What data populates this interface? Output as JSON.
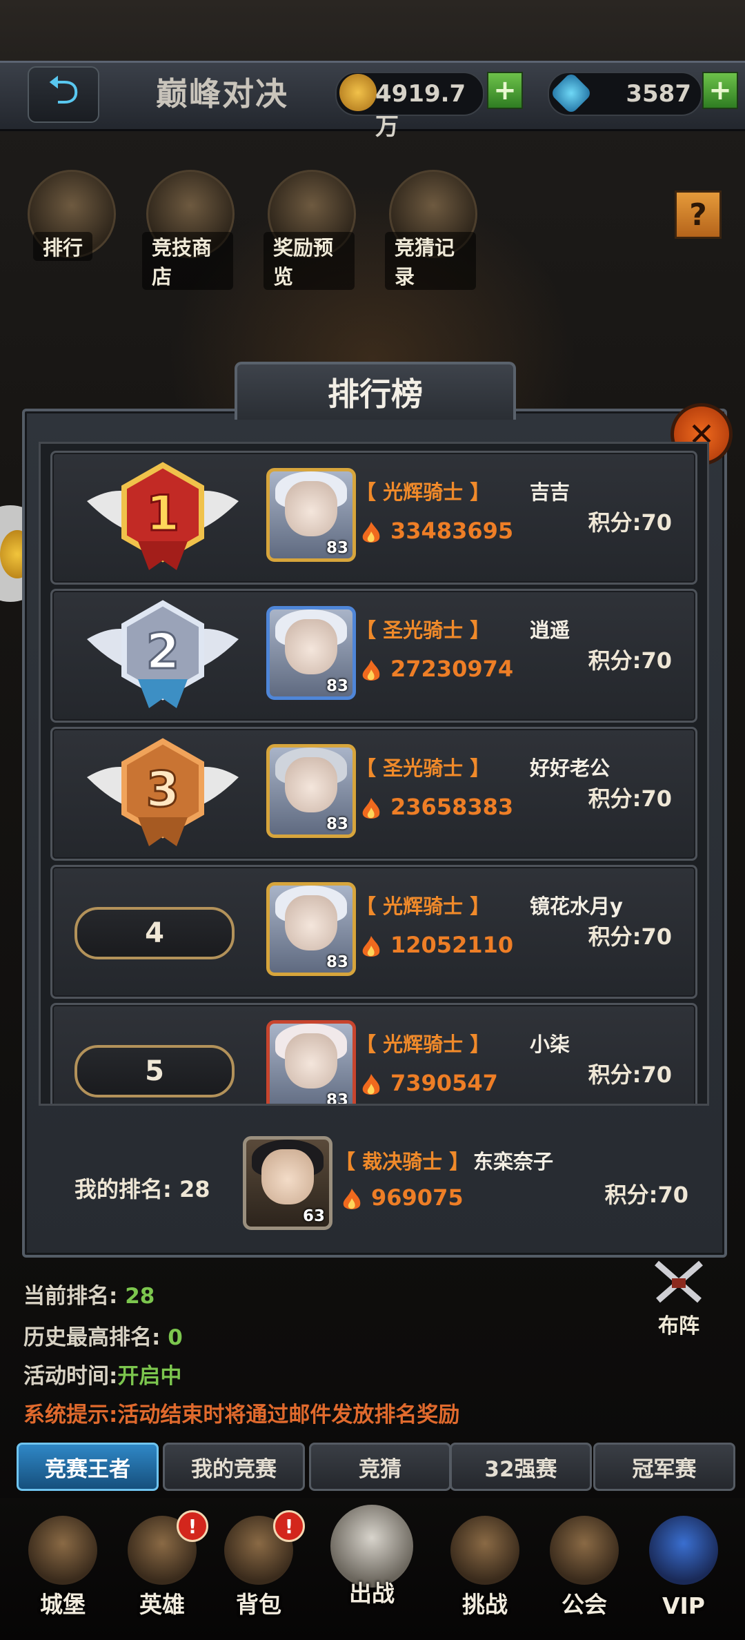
{
  "header": {
    "back_icon": "back-arrow-icon",
    "title": "巅峰对决",
    "gold": "4919.7万",
    "gems": "3587"
  },
  "top_menu": [
    {
      "label": "排行",
      "icon": "ranking-icon"
    },
    {
      "label": "竞技商店",
      "icon": "shop-icon"
    },
    {
      "label": "奖励预览",
      "icon": "reward-icon"
    },
    {
      "label": "竞猜记录",
      "icon": "scroll-icon"
    }
  ],
  "help_label": "?",
  "panel": {
    "title": "排行榜",
    "close_label": "✕"
  },
  "rankings": [
    {
      "rank": "1",
      "title": "【 光辉骑士 】",
      "name": "吉吉",
      "power": "33483695",
      "score": "积分:70",
      "level": "83"
    },
    {
      "rank": "2",
      "title": "【 圣光骑士 】",
      "name": "逍遥",
      "power": "27230974",
      "score": "积分:70",
      "level": "83"
    },
    {
      "rank": "3",
      "title": "【 圣光骑士 】",
      "name": "好好老公",
      "power": "23658383",
      "score": "积分:70",
      "level": "83"
    },
    {
      "rank": "4",
      "title": "【 光辉骑士 】",
      "name": "镜花水月y",
      "power": "12052110",
      "score": "积分:70",
      "level": "83"
    },
    {
      "rank": "5",
      "title": "【 光辉骑士 】",
      "name": "小柒",
      "power": "7390547",
      "score": "积分:70",
      "level": "83"
    }
  ],
  "my_rank": {
    "label": "我的排名: 28",
    "title": "【 裁决骑士 】",
    "name": "东栾奈子",
    "power": "969075",
    "score": "积分:70",
    "level": "63"
  },
  "info": {
    "current_label": "当前排名:",
    "current_value": "28",
    "best_label": "历史最高排名:",
    "best_value": "0",
    "time_label": "活动时间:",
    "time_value": "开启中",
    "system_note": "系统提示:活动结束时将通过邮件发放排名奖励",
    "formation": "布阵"
  },
  "tabs": [
    "竞赛王者",
    "我的竞赛",
    "竞猜",
    "32强赛",
    "冠军赛"
  ],
  "bottom_nav": [
    "城堡",
    "英雄",
    "背包",
    "出战",
    "挑战",
    "公会",
    "VIP"
  ],
  "badge_label": "!",
  "colors": {
    "accent_orange": "#f08a2a",
    "green": "#7cc64e",
    "tab_blue": "#2f87c6"
  }
}
